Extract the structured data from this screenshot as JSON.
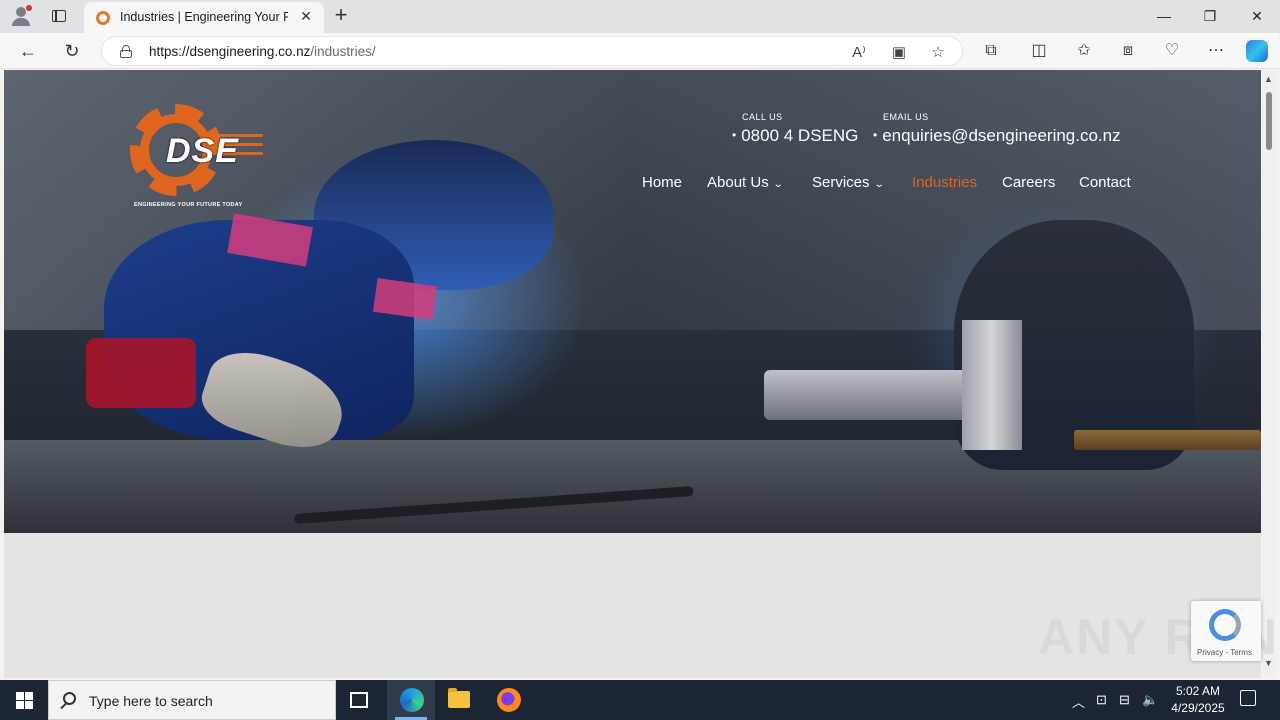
{
  "browser": {
    "tab_title": "Industries | Engineering Your Future Today",
    "new_tab": "+",
    "url_host": "https://dsengineering.co.nz",
    "url_path": "/industries/",
    "minimize": "—",
    "restore": "❐",
    "close": "✕"
  },
  "site": {
    "logo_text": "DSE",
    "logo_tagline": "ENGINEERING YOUR FUTURE TODAY",
    "call_label": "CALL US",
    "call_value": "0800 4 DSENG",
    "email_label": "EMAIL US",
    "email_value": "enquiries@dsengineering.co.nz",
    "nav": [
      {
        "label": "Home"
      },
      {
        "label": "About Us",
        "has_dropdown": true
      },
      {
        "label": "Services",
        "has_dropdown": true
      },
      {
        "label": "Industries",
        "active": true
      },
      {
        "label": "Careers"
      },
      {
        "label": "Contact"
      }
    ],
    "accent_color": "#e0661f"
  },
  "recaptcha": {
    "terms": "Privacy - Terms"
  },
  "watermark": "ANY RUN",
  "taskbar": {
    "search_placeholder": "Type here to search",
    "time": "5:02 AM",
    "date": "4/29/2025"
  }
}
